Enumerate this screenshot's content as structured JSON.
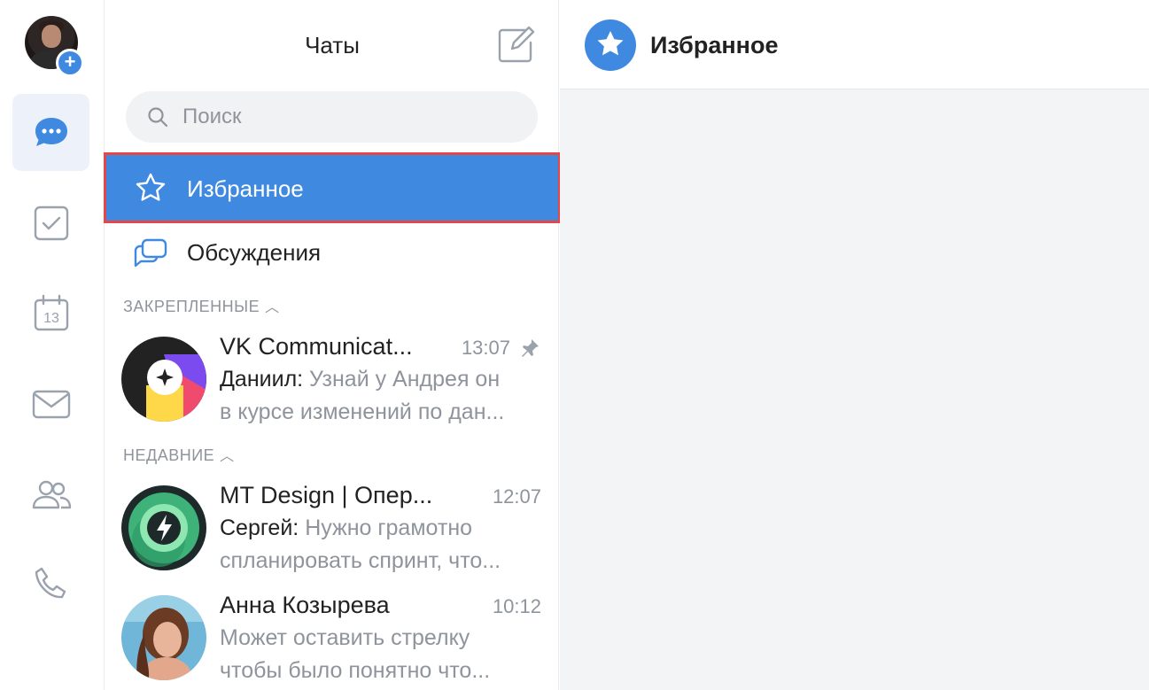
{
  "rail": {
    "items": [
      {
        "icon": "chat-bubble-icon",
        "active": true
      },
      {
        "icon": "checkbox-icon",
        "active": false
      },
      {
        "icon": "calendar-icon",
        "day": "13",
        "active": false
      },
      {
        "icon": "mail-icon",
        "active": false
      },
      {
        "icon": "contacts-icon",
        "active": false
      },
      {
        "icon": "phone-icon",
        "active": false
      }
    ],
    "accent": "#3f8ae0"
  },
  "list": {
    "title": "Чаты",
    "search_placeholder": "Поиск",
    "favorites_label": "Избранное",
    "discussions_label": "Обсуждения",
    "sections": {
      "pinned": "ЗАКРЕПЛЕННЫЕ",
      "recent": "НЕДАВНИЕ"
    },
    "chats": [
      {
        "name": "VK Communicat...",
        "time": "13:07",
        "pinned": true,
        "author": "Даниил:",
        "line1": " Узнай у Андрея он",
        "line2": "в курсе изменений по дан..."
      },
      {
        "name": "MT Design | Опер...",
        "time": "12:07",
        "pinned": false,
        "author": "Сергей:",
        "line1": " Нужно грамотно",
        "line2": "спланировать спринт, что..."
      },
      {
        "name": "Анна Козырева",
        "time": "10:12",
        "pinned": false,
        "author": "",
        "line1": "Может оставить стрелку",
        "line2": "чтобы было понятно что..."
      }
    ]
  },
  "pane": {
    "title": "Избранное"
  }
}
